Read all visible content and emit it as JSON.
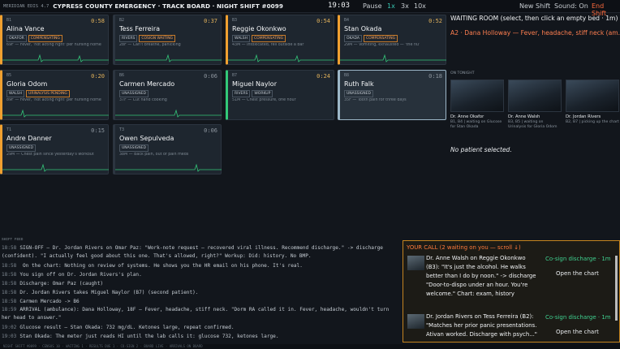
{
  "topbar": {
    "version": "MERIDIAN EDIS 4.7",
    "title": "CYPRESS COUNTY EMERGENCY · TRACK BOARD · NIGHT SHIFT #0099",
    "clock": "19:03",
    "pause": "Pause",
    "speed_1x": "1x",
    "speed_3x": "3x",
    "speed_10x": "10x",
    "new_shift": "New Shift",
    "sound": "Sound: On",
    "end_shift": "End Shift"
  },
  "beds": [
    {
      "bed": "B1",
      "time": "0:58",
      "name": "Alina Vance",
      "tags": [
        "OKAFOR",
        "COMPENSATING"
      ],
      "cc": "69F — Fever, 'not acting right' per nursing home"
    },
    {
      "bed": "B2",
      "time": "0:37",
      "name": "Tess Ferreira",
      "tags": [
        "RIVERS",
        "COSIGN WAITING"
      ],
      "cc": "28F — Can't breathe, panicking"
    },
    {
      "bed": "B3",
      "time": "0:54",
      "name": "Reggie Okonkwo",
      "tags": [
        "WALSH",
        "COMPENSATING"
      ],
      "cc": "43M — Intoxicated, fell outside a bar"
    },
    {
      "bed": "B4",
      "time": "0:52",
      "name": "Stan Okada",
      "tags": [
        "OKADA",
        "COMPENSATING"
      ],
      "cc": "29M — Vomiting, exhausted — 'the flu'"
    },
    {
      "bed": "B5",
      "time": "0:20",
      "name": "Gloria Odom",
      "tags": [
        "WALSH",
        "URINALYSIS PENDING"
      ],
      "cc": "89F — Fever, 'not acting right' per nursing home"
    },
    {
      "bed": "B6",
      "time": "0:06",
      "name": "Carmen Mercado",
      "tags": [
        "UNASSIGNED"
      ],
      "cc": "37F — Cut hand cooking"
    },
    {
      "bed": "B7",
      "time": "0:24",
      "name": "Miguel Naylor",
      "tags": [
        "RIVERS",
        "WORKUP"
      ],
      "cc": "51M — Chest pressure, one hour"
    },
    {
      "bed": "B8",
      "time": "0:18",
      "name": "Ruth Falk",
      "tags": [
        "UNASSIGNED"
      ],
      "cc": "35F — Tooth pain for three days"
    },
    {
      "bed": "T1",
      "time": "0:15",
      "name": "Andre Danner",
      "tags": [
        "UNASSIGNED"
      ],
      "cc": "29M — Chest pain since yesterday's workout"
    },
    {
      "bed": "T3",
      "time": "0:06",
      "name": "Owen Sepulveda",
      "tags": [
        "UNASSIGNED"
      ],
      "cc": "38M — Back pain, out of pain meds"
    }
  ],
  "waiting_room": {
    "title": "WAITING ROOM (select, then click an empty bed · 1m)",
    "patient": "A2 · Dana Holloway — Fever, headache, stiff neck (am..."
  },
  "on_tonight": {
    "label": "ON TONIGHT",
    "doctors": [
      {
        "name": "Dr. Anne Okafor",
        "status": "B1, B4 | waiting on Glucose for Stan Okada"
      },
      {
        "name": "Dr. Anne Walsh",
        "status": "B3, B5 | waiting on Urinalysis for Gloria Odom"
      },
      {
        "name": "Dr. Jordan Rivers",
        "status": "B2, B7 | picking up the chart"
      }
    ]
  },
  "no_selection": "No patient selected.",
  "feed": {
    "label": "SHIFT FEED",
    "lines": [
      {
        "t": "18:58",
        "text": "SIGN-OFF — Dr. Jordan Rivers on Omar Paz: \"Work-note request — recovered viral illness. Recommend discharge.\" -> discharge (confident). \"I actually feel good about this one. That's allowed, right?\" Workup: Did: history. No BMP.",
        "wrap": true
      },
      {
        "t": "18:58",
        "text": "    On the chart: Nothing on review of systems. He shows you the HR email on his phone. It's real."
      },
      {
        "t": "18:58",
        "text": "You sign off on Dr. Jordan Rivers's plan."
      },
      {
        "t": "18:58",
        "text": "Discharge: Omar Paz (caught)"
      },
      {
        "t": "18:58",
        "text": "Dr. Jordan Rivers takes Miguel Naylor (B7) (second patient)."
      },
      {
        "t": "18:58",
        "text": "Carmen Mercado -> B6"
      },
      {
        "t": "18:59",
        "text": "ARRIVAL (ambulance): Dana Holloway, 18F — Fever, headache, stiff neck. \"Dorm RA called it in. Fever, headache, wouldn't turn her head to answer.\"",
        "wrap": true
      },
      {
        "t": "19:02",
        "text": "Glucose result — Stan Okada: 732 mg/dL. Ketones large, repeat confirmed."
      },
      {
        "t": "19:03",
        "text": "Stan Okada: The meter just reads HI until the lab calls it: glucose 732, ketones large."
      }
    ]
  },
  "your_call": {
    "header": "YOUR CALL (2 waiting on you — scroll ↓)",
    "items": [
      {
        "text": "Dr. Anne Walsh on Reggie Okonkwo (B3): \"It's just the alcohol. He walks better than I do by noon.\" -> discharge \"Door-to-dispo under an hour. You're welcome.\" Chart: exam, history",
        "action": "Co-sign discharge · 1m",
        "chart": "Open the chart"
      },
      {
        "text": "Dr. Jordan Rivers on Tess Ferreira (B2): \"Matches her prior panic presentations. Ativan worked. Discharge with psych...\"",
        "action": "Co-sign discharge · 1m",
        "chart": "Open the chart"
      }
    ]
  },
  "statusbar": "NIGHT SHIFT #0099 · CENSUS 10 · WAITING 1 · RESULTS DUE 1 · CO-SIGN 2 · BOARD LIVE · ARRIVALS ON BOARD"
}
